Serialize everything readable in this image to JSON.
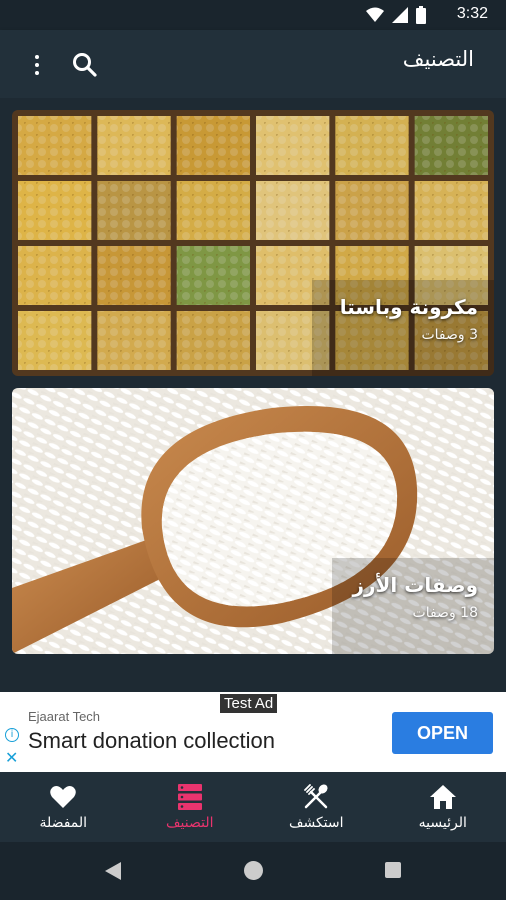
{
  "status_bar": {
    "time": "3:32"
  },
  "app_bar": {
    "title": "التصنيف"
  },
  "categories": [
    {
      "name": "مكرونة وباستا",
      "count": "3 وصفات"
    },
    {
      "name": "وصفات الأرز",
      "count": "18 وصفات"
    }
  ],
  "ad": {
    "tag": "Test Ad",
    "advertiser": "Ejaarat Tech",
    "headline": "Smart donation collection",
    "button": "OPEN"
  },
  "bottom_nav": [
    {
      "label": "المفضلة",
      "icon": "heart-icon"
    },
    {
      "label": "التصنيف",
      "icon": "category-list-icon",
      "active": true
    },
    {
      "label": "استكشف",
      "icon": "fork-spoon-icon"
    },
    {
      "label": "الرئيسيه",
      "icon": "home-icon"
    }
  ],
  "colors": {
    "active": "#e9346e",
    "bar": "#22303a",
    "background": "#1e2a33",
    "ad_button": "#2a7de1"
  }
}
